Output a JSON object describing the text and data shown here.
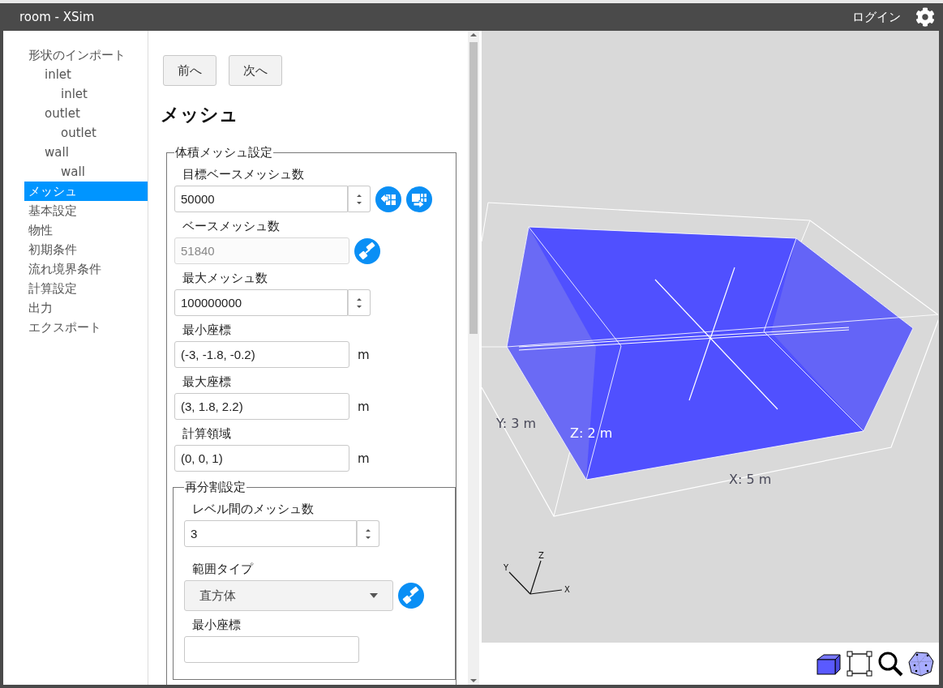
{
  "window": {
    "title": "room - XSim"
  },
  "header": {
    "login": "ログイン"
  },
  "sidebar": {
    "items": [
      {
        "label": "形状のインポート",
        "selected": false,
        "children": [
          {
            "label": "inlet",
            "selected": false,
            "children": [
              {
                "label": "inlet",
                "selected": false
              }
            ]
          },
          {
            "label": "outlet",
            "selected": false,
            "children": [
              {
                "label": "outlet",
                "selected": false
              }
            ]
          },
          {
            "label": "wall",
            "selected": false,
            "children": [
              {
                "label": "wall",
                "selected": false
              }
            ]
          }
        ]
      },
      {
        "label": "メッシュ",
        "selected": true
      },
      {
        "label": "基本設定",
        "selected": false
      },
      {
        "label": "物性",
        "selected": false
      },
      {
        "label": "初期条件",
        "selected": false
      },
      {
        "label": "流れ境界条件",
        "selected": false
      },
      {
        "label": "計算設定",
        "selected": false
      },
      {
        "label": "出力",
        "selected": false
      },
      {
        "label": "エクスポート",
        "selected": false
      }
    ]
  },
  "nav_buttons": [
    {
      "label": "前へ"
    },
    {
      "label": "次へ"
    }
  ],
  "heading": "メッシュ",
  "volume_mesh": {
    "legend": "体積メッシュ設定",
    "fields": [
      {
        "kind": "spinner",
        "label": "目標ベースメッシュ数",
        "value": "50000",
        "disabled": false,
        "actions": [
          {
            "kind": "grid-in"
          },
          {
            "kind": "grid-out"
          }
        ]
      },
      {
        "kind": "text",
        "label": "ベースメッシュ数",
        "value": "51840",
        "disabled": true,
        "actions": [
          {
            "kind": "roller"
          }
        ]
      },
      {
        "kind": "spinner",
        "label": "最大メッシュ数",
        "value": "100000000",
        "disabled": false
      },
      {
        "kind": "text",
        "label": "最小座標",
        "value": "(-3, -1.8, -0.2)",
        "unit": "m",
        "disabled": false
      },
      {
        "kind": "text",
        "label": "最大座標",
        "value": "(3, 1.8, 2.2)",
        "unit": "m",
        "disabled": false
      },
      {
        "kind": "text",
        "label": "計算領域",
        "value": "(0, 0, 1)",
        "unit": "m",
        "disabled": false
      }
    ],
    "refinement": {
      "legend": "再分割設定",
      "fields": [
        {
          "kind": "spinner",
          "label": "レベル間のメッシュ数",
          "value": "3",
          "disabled": false
        },
        {
          "kind": "select",
          "label": "範囲タイプ",
          "value": "直方体",
          "disabled": false,
          "actions": [
            {
              "kind": "roller"
            }
          ]
        },
        {
          "kind": "text",
          "label": "最小座標",
          "disabled": false
        }
      ]
    }
  },
  "viewer": {
    "dimension_labels": [
      "Y: 3 m",
      "Z: 2 m",
      "X: 5 m"
    ],
    "axis_labels": [
      "X",
      "Y",
      "Z"
    ]
  }
}
